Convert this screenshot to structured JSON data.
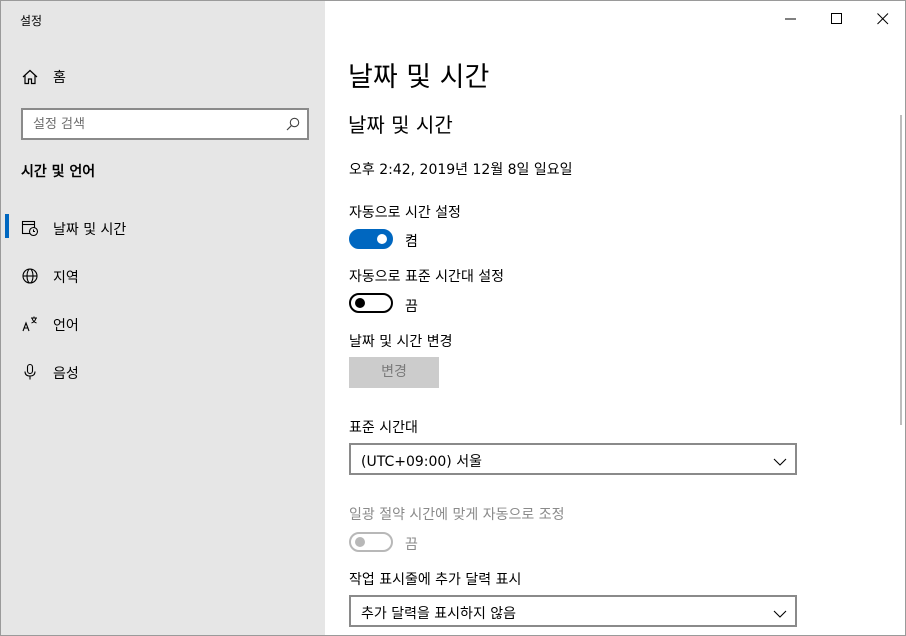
{
  "window": {
    "title": "설정"
  },
  "sidebar": {
    "home_label": "홈",
    "search_placeholder": "설정 검색",
    "section_title": "시간 및 언어",
    "items": [
      {
        "label": "날짜 및 시간",
        "icon": "calendar-clock-icon",
        "active": true
      },
      {
        "label": "지역",
        "icon": "globe-icon",
        "active": false
      },
      {
        "label": "언어",
        "icon": "language-icon",
        "active": false
      },
      {
        "label": "음성",
        "icon": "microphone-icon",
        "active": false
      }
    ]
  },
  "main": {
    "page_title": "날짜 및 시간",
    "subtitle": "날짜 및 시간",
    "current_datetime": "오후 2:42, 2019년 12월 8일 일요일",
    "auto_time": {
      "label": "자동으로 시간 설정",
      "state": "켬",
      "on": true
    },
    "auto_timezone": {
      "label": "자동으로 표준 시간대 설정",
      "state": "끔",
      "on": false
    },
    "change_section": {
      "label": "날짜 및 시간 변경",
      "button": "변경"
    },
    "timezone": {
      "label": "표준 시간대",
      "value": "(UTC+09:00) 서울"
    },
    "dst": {
      "label": "일광 절약 시간에 맞게 자동으로 조정",
      "state": "끔",
      "enabled": false
    },
    "calendar": {
      "label": "작업 표시줄에 추가 달력 표시",
      "value": "추가 달력을 표시하지 않음"
    }
  },
  "colors": {
    "accent": "#0067c0",
    "sidebar_bg": "#e6e6e6",
    "disabled_text": "#8a8a8a"
  }
}
